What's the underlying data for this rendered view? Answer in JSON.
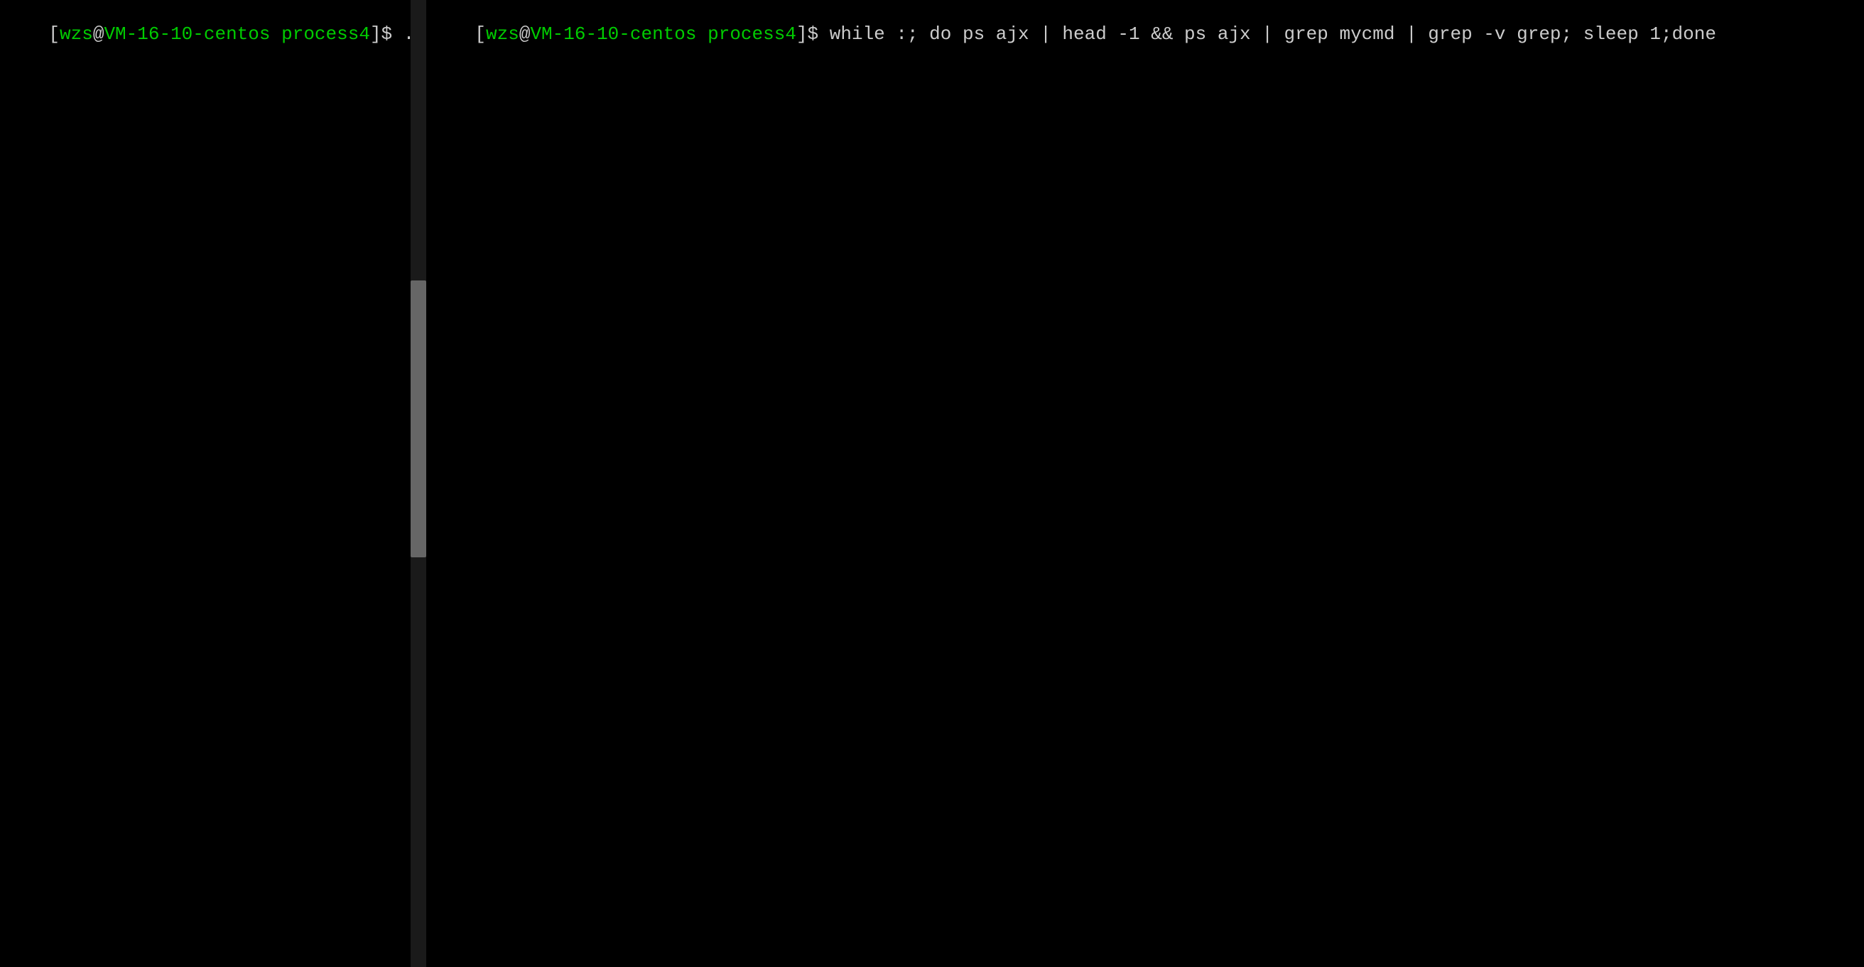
{
  "left_pane": {
    "prompt": {
      "bracket_open": "[",
      "user": "wzs",
      "at": "@",
      "host": "VM-16-10-centos",
      "space": " ",
      "dir": "process4",
      "bracket_close": "]",
      "dollar": "$",
      "command": " ./mycmd"
    }
  },
  "right_pane": {
    "prompt": {
      "bracket_open": "[",
      "user": "wzs",
      "at": "@",
      "host": "VM-16-10-centos",
      "space": " ",
      "dir": "process4",
      "bracket_close": "]",
      "dollar": "$",
      "command": " while :; do ps ajx | head -1 && ps ajx | grep mycmd | grep -v grep; sleep 1;done"
    }
  },
  "colors": {
    "background": "#000000",
    "text": "#cccccc",
    "prompt_green": "#00cc00",
    "scrollbar_thumb": "#666666",
    "scrollbar_track": "#1a1a1a"
  }
}
